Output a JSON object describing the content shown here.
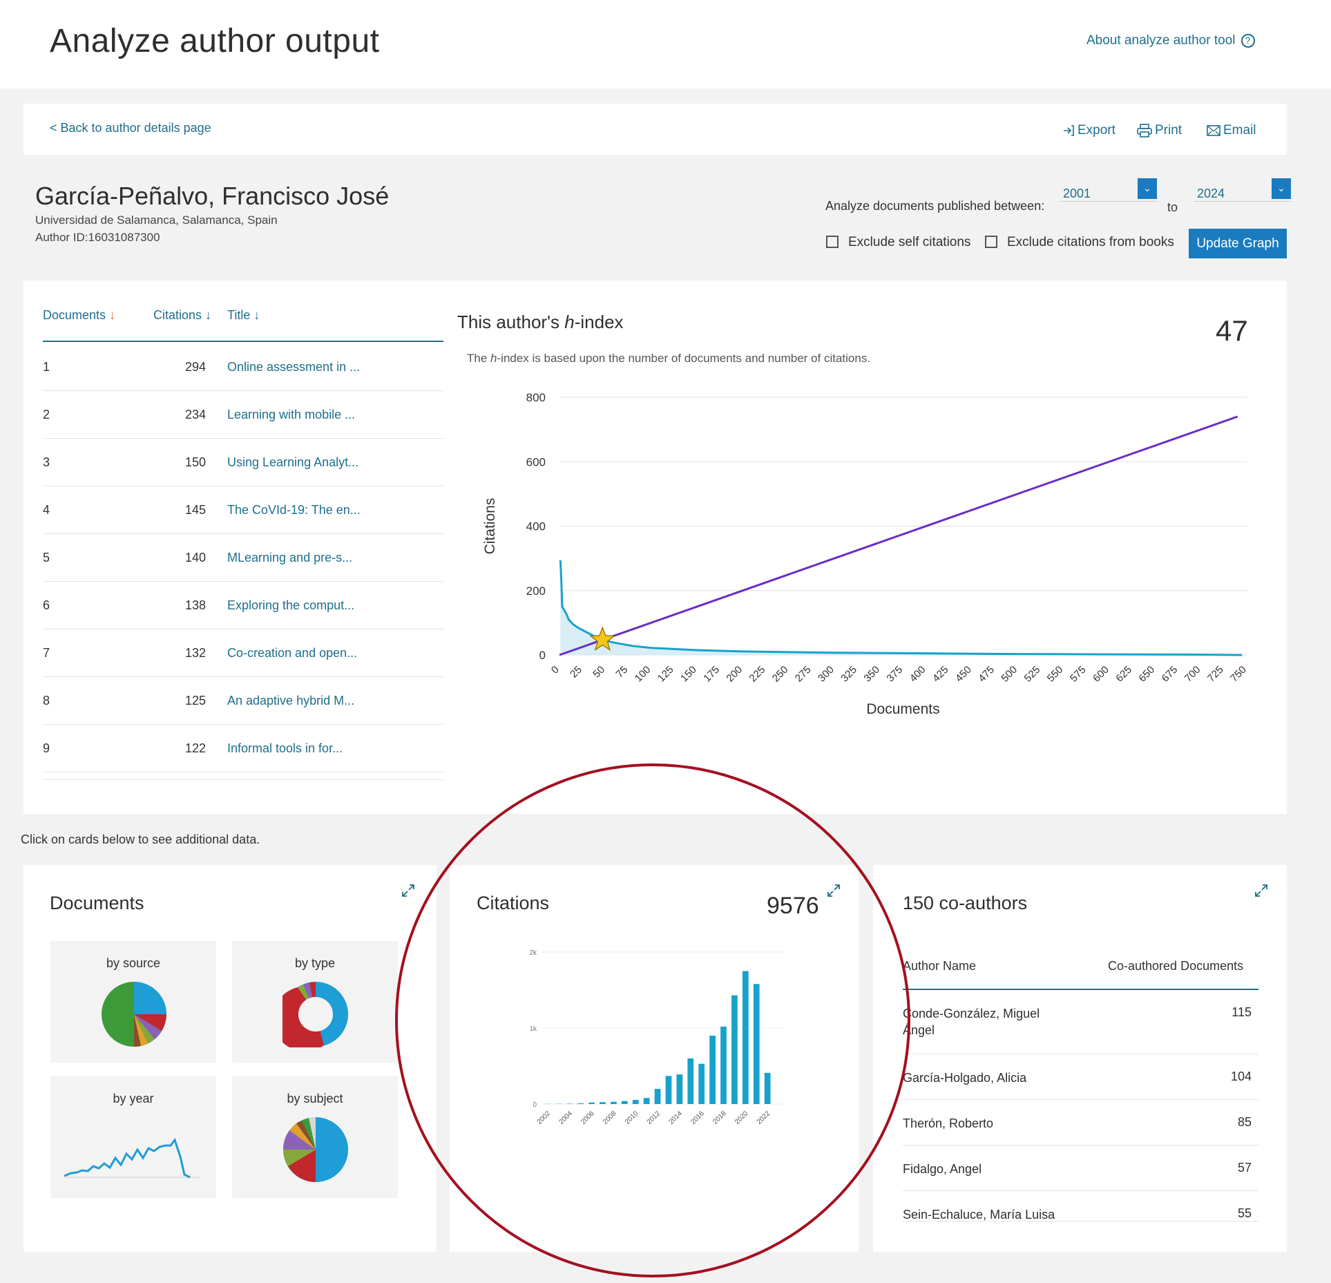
{
  "page": {
    "title": "Analyze author output",
    "about_link": "About analyze author tool",
    "help_glyph": "?"
  },
  "toolbar": {
    "back": "< Back to author details page",
    "export": "Export",
    "print": "Print",
    "email": "Email"
  },
  "author": {
    "name": "García-Peñalvo, Francisco José",
    "affiliation": "Universidad de Salamanca, Salamanca, Spain",
    "author_id": "Author ID:16031087300"
  },
  "filters": {
    "range_label": "Analyze documents published between:",
    "from_year": "2001",
    "to_label": "to",
    "to_year": "2024",
    "exclude_self": "Exclude self citations",
    "exclude_books": "Exclude citations from books",
    "update_button": "Update Graph"
  },
  "doc_table": {
    "headers": {
      "documents": "Documents",
      "citations": "Citations",
      "title": "Title"
    },
    "rows": [
      {
        "rank": "1",
        "citations": "294",
        "title": "Online assessment in ..."
      },
      {
        "rank": "2",
        "citations": "234",
        "title": "Learning with mobile ..."
      },
      {
        "rank": "3",
        "citations": "150",
        "title": "Using Learning Analyt..."
      },
      {
        "rank": "4",
        "citations": "145",
        "title": "The CoVId-19: The en..."
      },
      {
        "rank": "5",
        "citations": "140",
        "title": "MLearning and pre-s..."
      },
      {
        "rank": "6",
        "citations": "138",
        "title": "Exploring the comput..."
      },
      {
        "rank": "7",
        "citations": "132",
        "title": "Co-creation and open..."
      },
      {
        "rank": "8",
        "citations": "125",
        "title": "An adaptive hybrid M..."
      },
      {
        "rank": "9",
        "citations": "122",
        "title": "Informal tools in for..."
      }
    ]
  },
  "hindex": {
    "title_prefix": "This author's ",
    "title_h": "h",
    "title_suffix": "-index",
    "value": "47",
    "desc_prefix": "The ",
    "desc_h": "h",
    "desc_suffix": "-index is based upon the number of documents and number of citations."
  },
  "click_note": "Click on cards below to see additional data.",
  "cards": {
    "documents": {
      "title": "Documents",
      "by_source": "by source",
      "by_type": "by type",
      "by_year": "by year",
      "by_subject": "by subject"
    },
    "citations": {
      "title": "Citations",
      "total": "9576"
    },
    "coauthors": {
      "title": "150 co-authors",
      "header_name": "Author Name",
      "header_docs": "Co-authored Documents",
      "rows": [
        {
          "name": "Conde-González, Miguel Ángel",
          "count": "115"
        },
        {
          "name": "García-Holgado, Alicia",
          "count": "104"
        },
        {
          "name": "Therón, Roberto",
          "count": "85"
        },
        {
          "name": "Fidalgo, Angel",
          "count": "57"
        },
        {
          "name": "Sein-Echaluce, María Luisa",
          "count": "55"
        }
      ]
    }
  },
  "colors": {
    "accent": "#1e6e8c",
    "button": "#1a7bc0",
    "citation_line": "#17a2cc",
    "h_line": "#6a2dc9",
    "star": "#f5c518",
    "highlight_ring": "#a3101f"
  },
  "icons": [
    "help-icon",
    "export-icon",
    "print-icon",
    "email-icon",
    "chevron-down-icon",
    "expand-icon",
    "star-icon"
  ],
  "chart_data": [
    {
      "type": "line",
      "title": "This author's h-index",
      "xlabel": "Documents",
      "ylabel": "Citations",
      "xlim": [
        0,
        750
      ],
      "ylim": [
        0,
        800
      ],
      "x_ticks": [
        0,
        25,
        50,
        75,
        100,
        125,
        150,
        175,
        200,
        225,
        250,
        275,
        300,
        325,
        350,
        375,
        400,
        425,
        450,
        475,
        500,
        525,
        550,
        575,
        600,
        625,
        650,
        675,
        700,
        725,
        750
      ],
      "y_ticks": [
        0,
        200,
        400,
        600,
        800
      ],
      "grid": true,
      "series": [
        {
          "x": [
            1,
            2,
            3,
            5,
            8,
            10,
            15,
            20,
            30,
            40,
            47,
            60,
            80,
            100,
            150,
            200,
            300,
            400,
            500,
            600,
            700,
            745
          ],
          "y": [
            294,
            234,
            150,
            140,
            125,
            110,
            95,
            85,
            70,
            55,
            47,
            38,
            28,
            22,
            15,
            11,
            7,
            5,
            3,
            2,
            1,
            0
          ]
        },
        {
          "x": [
            0,
            740
          ],
          "y": [
            0,
            740
          ]
        }
      ],
      "h_index": 47
    },
    {
      "type": "bar",
      "title": "Citations",
      "categories": [
        "2002",
        "2003",
        "2004",
        "2005",
        "2006",
        "2007",
        "2008",
        "2009",
        "2010",
        "2011",
        "2012",
        "2013",
        "2014",
        "2015",
        "2016",
        "2017",
        "2018",
        "2019",
        "2020",
        "2021",
        "2022",
        "2023"
      ],
      "x_tick_labels": [
        "2002",
        "2004",
        "2006",
        "2008",
        "2010",
        "2012",
        "2014",
        "2016",
        "2018",
        "2020",
        "2022"
      ],
      "y_tick_labels": [
        "0",
        "1k",
        "2k"
      ],
      "values": [
        2,
        3,
        5,
        10,
        20,
        25,
        30,
        40,
        55,
        80,
        200,
        370,
        390,
        600,
        530,
        900,
        1020,
        1430,
        1750,
        1580,
        410,
        0
      ],
      "ylim": [
        0,
        2000
      ]
    }
  ]
}
